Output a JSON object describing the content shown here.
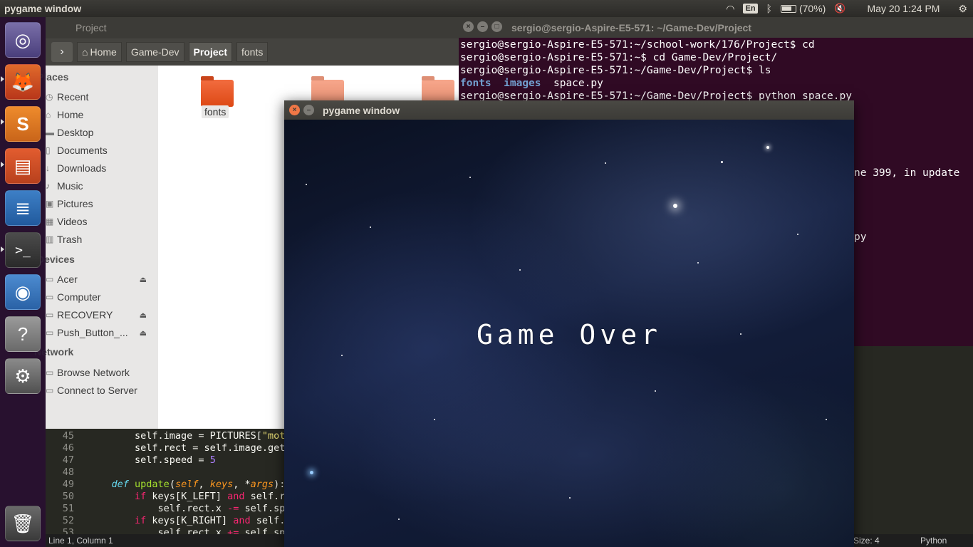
{
  "top_panel": {
    "title": "pygame window",
    "keyboard": "En",
    "battery": "(70%)",
    "datetime": "May 20  1:24 PM"
  },
  "launcher": {
    "items": [
      {
        "name": "ubuntu-dash-icon",
        "glyph": "◎"
      },
      {
        "name": "firefox-icon",
        "glyph": "🦊"
      },
      {
        "name": "sublime-text-icon",
        "glyph": "S"
      },
      {
        "name": "files-icon",
        "glyph": "▤"
      },
      {
        "name": "writer-icon",
        "glyph": "≣"
      },
      {
        "name": "terminal-icon",
        "glyph": ">_"
      },
      {
        "name": "chrome-icon",
        "glyph": "◉"
      },
      {
        "name": "help-icon",
        "glyph": "?"
      },
      {
        "name": "settings-icon",
        "glyph": "⚙"
      },
      {
        "name": "trash-icon",
        "glyph": "🗑"
      }
    ]
  },
  "files": {
    "title": "Project",
    "breadcrumb": [
      "Home",
      "Game-Dev",
      "Project",
      "fonts"
    ],
    "places_header": "Places",
    "places": [
      "Recent",
      "Home",
      "Desktop",
      "Documents",
      "Downloads",
      "Music",
      "Pictures",
      "Videos",
      "Trash"
    ],
    "devices_header": "Devices",
    "devices": [
      "Acer",
      "Computer",
      "RECOVERY",
      "Push_Button_..."
    ],
    "network_header": "Network",
    "network": [
      "Browse Network",
      "Connect to Server"
    ],
    "folder_label": "fonts"
  },
  "terminal": {
    "title": "sergio@sergio-Aspire-E5-571: ~/Game-Dev/Project",
    "lines": [
      "sergio@sergio-Aspire-E5-571:~/school-work/176/Project$ cd",
      "sergio@sergio-Aspire-E5-571:~$ cd Game-Dev/Project/",
      "sergio@sergio-Aspire-E5-571:~/Game-Dev/Project$ ls",
      "sergio@sergio-Aspire-E5-571:~/Game-Dev/Project$ python space.py"
    ],
    "ls_dir1": "fonts",
    "ls_dir2": "images",
    "ls_file": "space.py",
    "fragment1": "ne 399, in update",
    "fragment2": "py"
  },
  "editor": {
    "line_numbers": [
      "45",
      "46",
      "47",
      "48",
      "49",
      "50",
      "51",
      "52",
      "53"
    ],
    "status_left": "Line 1, Column 1",
    "status_size": "Size: 4",
    "status_lang": "Python"
  },
  "pygame": {
    "title": "pygame window",
    "message": "Game Over"
  }
}
